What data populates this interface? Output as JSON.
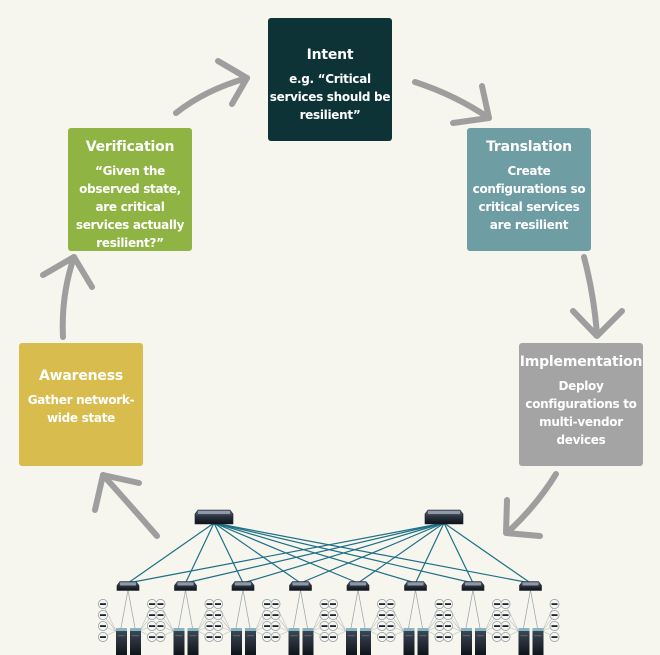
{
  "diagram": {
    "type": "cycle",
    "stages": [
      {
        "id": "intent",
        "title": "Intent",
        "body": "e.g. “Critical services should be resilient”",
        "color": "#0e3336"
      },
      {
        "id": "translation",
        "title": "Translation",
        "body": "Create configurations so critical services are resilient",
        "color": "#6f9da4"
      },
      {
        "id": "implementation",
        "title": "Implementation",
        "body": "Deploy configurations to multi-vendor devices",
        "color": "#a4a4a4"
      },
      {
        "id": "awareness",
        "title": "Awareness",
        "body": "Gather network-wide state",
        "color": "#d8bd4e"
      },
      {
        "id": "verification",
        "title": "Verification",
        "body": "“Given the observed state, are critical services actually resilient?”",
        "color": "#8fb443"
      }
    ],
    "flow": [
      "intent",
      "translation",
      "implementation",
      "network",
      "awareness",
      "verification",
      "intent"
    ],
    "arrow_color": "#9e9e9e",
    "network": {
      "spine_count": 2,
      "leaf_count": 8,
      "servers_per_leaf": 2,
      "endpoints_per_side": 4,
      "link_color": "#1f6f86"
    }
  }
}
